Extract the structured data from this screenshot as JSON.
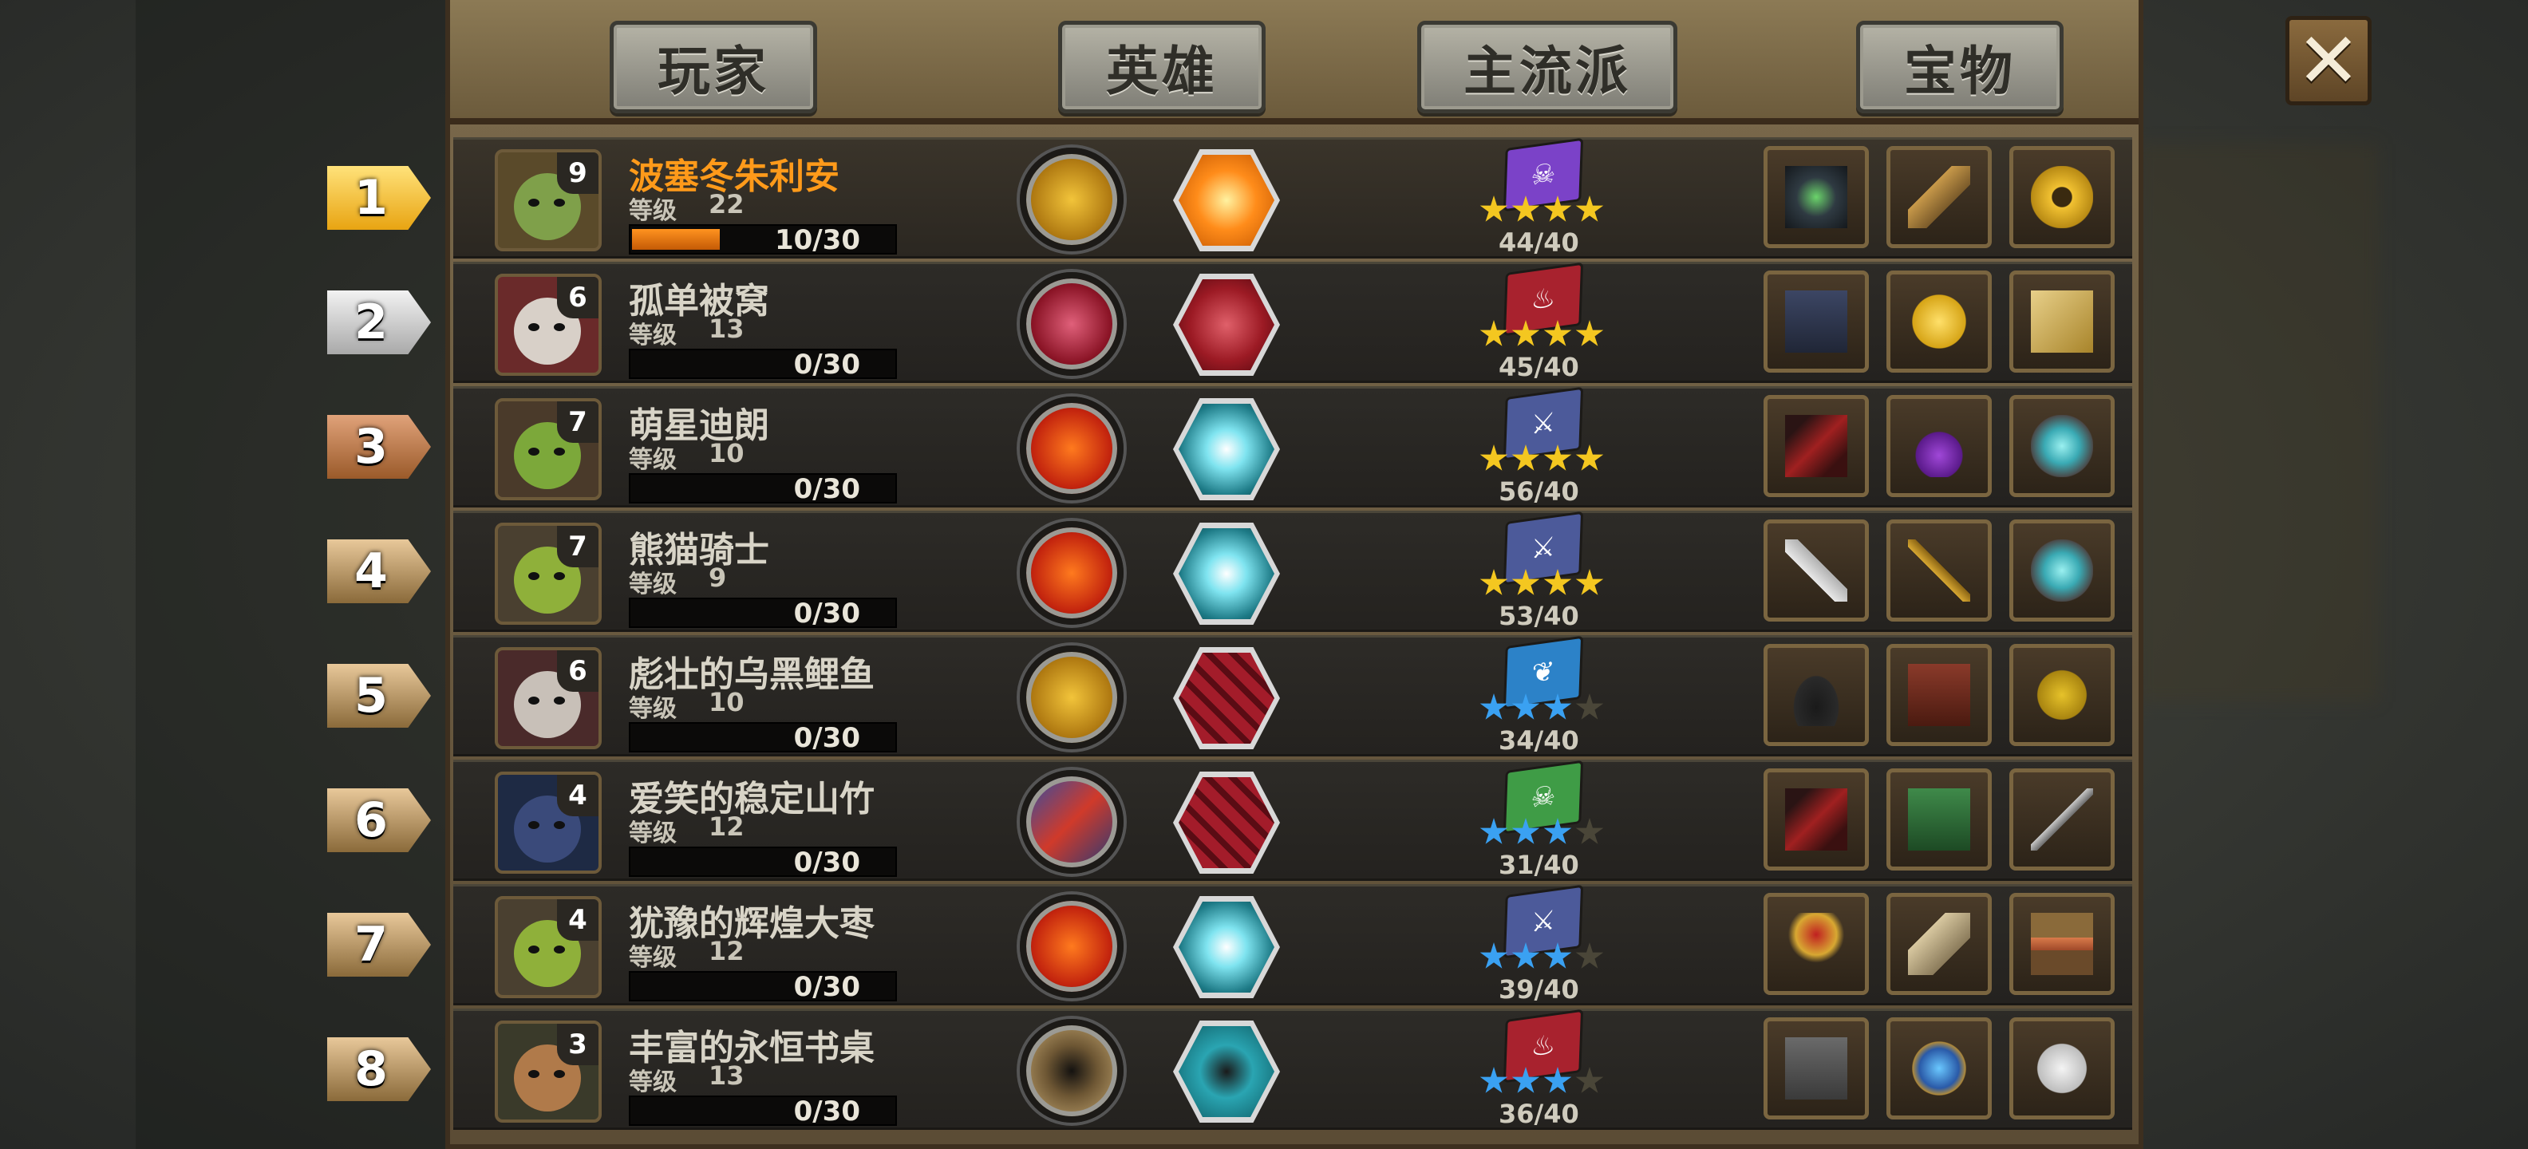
{
  "tabs": [
    "玩家",
    "英雄",
    "主流派",
    "宝物"
  ],
  "close_label": "✕",
  "level_label": "等级",
  "colors": {
    "gold_name": "#ff9a1a",
    "xp_fill": "#ff9320",
    "star_gold": "#f4c720",
    "star_blue": "#3aa1f2"
  },
  "rows": [
    {
      "rank": "1",
      "name": "波塞冬朱利安",
      "level": "22",
      "xp": "10/30",
      "xp_fraction": 0.33,
      "badge": "9",
      "deck": "44/40",
      "stars": {
        "count": 4,
        "color": "gold"
      },
      "hero_icon": "gold-coins-icon",
      "skill_icon": "orange-star-coin-icon",
      "book_icon": "purple-skull-book-icon",
      "treasures": [
        "dark-crystal-icon",
        "telescope-icon",
        "gold-gear-icon"
      ]
    },
    {
      "rank": "2",
      "name": "孤单被窝",
      "level": "13",
      "xp": "0/30",
      "xp_fraction": 0,
      "badge": "6",
      "deck": "45/40",
      "stars": {
        "count": 4,
        "color": "gold"
      },
      "hero_icon": "red-claw-icon",
      "skill_icon": "red-blade-hex-icon",
      "book_icon": "red-fire-book-icon",
      "treasures": [
        "spell-book-icon",
        "gold-medal-icon",
        "vip-card-icon"
      ]
    },
    {
      "rank": "3",
      "name": "萌星迪朗",
      "level": "10",
      "xp": "0/30",
      "xp_fraction": 0,
      "badge": "7",
      "deck": "56/40",
      "stars": {
        "count": 4,
        "color": "gold"
      },
      "hero_icon": "sword-slash-icon",
      "skill_icon": "lightning-orb-hex-icon",
      "book_icon": "sword-book-icon",
      "treasures": [
        "red-boot-icon",
        "purple-potion-icon",
        "crystal-ore-icon"
      ]
    },
    {
      "rank": "4",
      "name": "熊猫骑士",
      "level": "9",
      "xp": "0/30",
      "xp_fraction": 0,
      "badge": "7",
      "deck": "53/40",
      "stars": {
        "count": 4,
        "color": "gold"
      },
      "hero_icon": "sword-slash-icon",
      "skill_icon": "lightning-orb-hex-icon",
      "book_icon": "sword-book-icon",
      "treasures": [
        "dagger-icon",
        "golden-staff-icon",
        "crystal-ore-icon"
      ]
    },
    {
      "rank": "5",
      "name": "彪壮的乌黑鲤鱼",
      "level": "10",
      "xp": "0/30",
      "xp_fraction": 0,
      "badge": "6",
      "deck": "34/40",
      "stars": {
        "count": 3,
        "color": "blue"
      },
      "hero_icon": "gold-coins-icon",
      "skill_icon": "red-chain-hex-icon",
      "book_icon": "blue-leaf-book-icon",
      "treasures": [
        "pirate-hat-icon",
        "leather-armor-icon",
        "clover-icon"
      ]
    },
    {
      "rank": "6",
      "name": "爱笑的稳定山竹",
      "level": "12",
      "xp": "0/30",
      "xp_fraction": 0,
      "badge": "4",
      "deck": "31/40",
      "stars": {
        "count": 3,
        "color": "blue"
      },
      "hero_icon": "blue-red-slash-icon",
      "skill_icon": "red-chain-hex-icon",
      "book_icon": "green-skull-book-icon",
      "treasures": [
        "red-boot-icon",
        "green-books-icon",
        "spear-icon"
      ]
    },
    {
      "rank": "7",
      "name": "犹豫的辉煌大枣",
      "level": "12",
      "xp": "0/30",
      "xp_fraction": 0,
      "badge": "4",
      "deck": "39/40",
      "stars": {
        "count": 3,
        "color": "blue"
      },
      "hero_icon": "sword-slash-icon",
      "skill_icon": "lightning-orb-hex-icon",
      "book_icon": "sword-book-icon",
      "treasures": [
        "golden-chalice-icon",
        "scroll-icon",
        "meat-crate-icon"
      ]
    },
    {
      "rank": "8",
      "name": "丰富的永恒书桌",
      "level": "13",
      "xp": "0/30",
      "xp_fraction": 0,
      "badge": "3",
      "deck": "36/40",
      "stars": {
        "count": 3,
        "color": "blue"
      },
      "hero_icon": "bronze-gear-icon",
      "skill_icon": "missile-hex-icon",
      "book_icon": "red-fire-book-icon",
      "treasures": [
        "stone-tablet-icon",
        "blue-lantern-icon",
        "white-glove-icon"
      ]
    }
  ]
}
